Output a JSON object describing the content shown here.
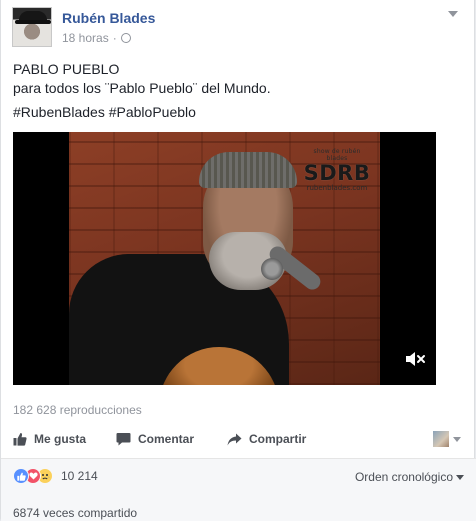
{
  "post": {
    "author": "Rubén Blades",
    "time": "18 horas",
    "meta_separator": "·",
    "icons": {
      "privacy": "globe-icon",
      "options": "chevron-down-icon"
    },
    "text_lines": [
      "PABLO PUEBLO",
      "para todos los ¨Pablo Pueblo¨ del Mundo."
    ],
    "hashtags": "#RubenBlades #PabloPueblo"
  },
  "video": {
    "watermark_top": "show de rubén blades",
    "watermark_logo": "SDRB",
    "watermark_url": "rubenblades.com",
    "mute_icon": "speaker-muted-icon"
  },
  "stats": {
    "views": "182 628 reproducciones",
    "reaction_count": "10 214",
    "shares": "6874 veces compartido",
    "reaction_icons": [
      "like-reaction-icon",
      "love-reaction-icon",
      "sad-reaction-icon"
    ]
  },
  "actions": {
    "like": "Me gusta",
    "comment": "Comentar",
    "share": "Compartir"
  },
  "comments": {
    "order_label": "Orden cronológico"
  },
  "colors": {
    "brand_link": "#365899",
    "like_blue": "#5890ff",
    "love_red": "#f25268",
    "sad_yellow": "#fbd15b"
  }
}
